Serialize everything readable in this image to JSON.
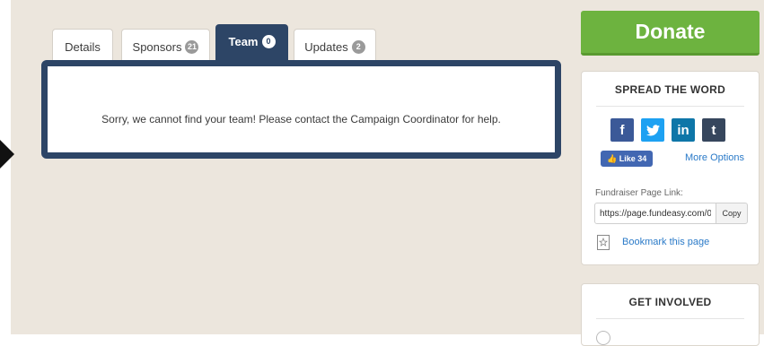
{
  "tabs": [
    {
      "label": "Details",
      "badge": ""
    },
    {
      "label": "Sponsors",
      "badge": "21"
    },
    {
      "label": "Team",
      "badge": "0"
    },
    {
      "label": "Updates",
      "badge": "2"
    }
  ],
  "active_tab": "Team",
  "panel": {
    "message": "Sorry, we cannot find your team! Please contact the Campaign Coordinator for help."
  },
  "donate": {
    "label": "Donate"
  },
  "spread": {
    "title": "SPREAD THE WORD",
    "social": [
      {
        "icon": "facebook-icon",
        "glyph": "f"
      },
      {
        "icon": "twitter-icon",
        "glyph": "🐦"
      },
      {
        "icon": "linkedin-icon",
        "glyph": "in"
      },
      {
        "icon": "tumblr-icon",
        "glyph": "t"
      }
    ],
    "like_label": "Like 34",
    "more_options": "More Options",
    "link_label": "Fundraiser Page Link:",
    "link_value": "https://page.fundeasy.com/0",
    "copy_label": "Copy",
    "bookmark_label": "Bookmark this page"
  },
  "involved": {
    "title": "GET INVOLVED"
  },
  "colors": {
    "accent_navy": "#2d4566",
    "donate_green": "#6db33f",
    "link_blue": "#2a7ac8",
    "page_bg": "#ece6dd"
  }
}
